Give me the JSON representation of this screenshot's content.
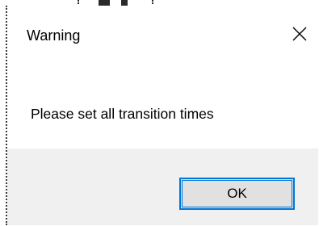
{
  "dialog": {
    "title": "Warning",
    "message": "Please set all transition times",
    "ok_label": "OK",
    "close_icon": "close-icon"
  },
  "colors": {
    "button_border": "#0078d7",
    "button_face": "#e1e1e1",
    "footer_bg": "#f0f0f0",
    "dialog_bg": "#ffffff"
  }
}
